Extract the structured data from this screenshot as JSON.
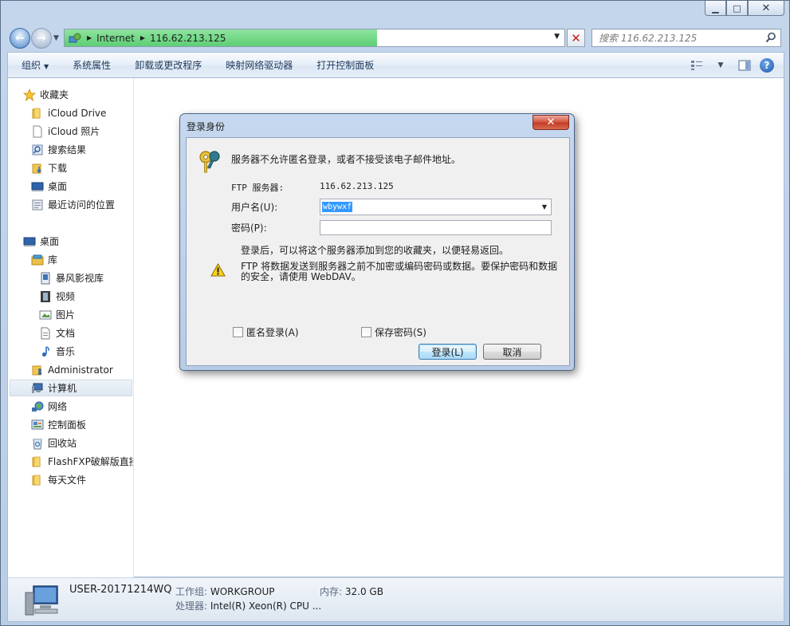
{
  "window": {
    "address": {
      "segments": [
        "Internet",
        "116.62.213.125"
      ]
    },
    "search": {
      "placeholder": "搜索 116.62.213.125"
    }
  },
  "toolbar": {
    "organize": "组织",
    "system_properties": "系统属性",
    "uninstall": "卸载或更改程序",
    "map_drive": "映射网络驱动器",
    "control_panel": "打开控制面板"
  },
  "sidebar": {
    "favorites": {
      "label": "收藏夹",
      "items": [
        "iCloud Drive",
        "iCloud 照片",
        "搜索结果",
        "下载",
        "桌面",
        "最近访问的位置"
      ]
    },
    "desktop": {
      "label": "桌面",
      "library": "库",
      "library_items": [
        "暴风影视库",
        "视频",
        "图片",
        "文档",
        "音乐"
      ],
      "items": [
        "Administrator",
        "计算机",
        "网络",
        "控制面板",
        "回收站",
        "FlashFXP破解版直接",
        "每天文件"
      ]
    }
  },
  "status": {
    "computer_name": "USER-20171214WQ",
    "workgroup_label": "工作组:",
    "workgroup_value": "WORKGROUP",
    "memory_label": "内存:",
    "memory_value": "32.0 GB",
    "cpu_label": "处理器:",
    "cpu_value": "Intel(R) Xeon(R) CPU ..."
  },
  "dialog": {
    "title": "登录身份",
    "message": "服务器不允许匿名登录，或者不接受该电子邮件地址。",
    "ftp_server_label": "FTP 服务器:",
    "ftp_server_value": "116.62.213.125",
    "username_label": "用户名(U):",
    "username_value": "wbywxf",
    "password_label": "密码(P):",
    "info_text": "登录后，可以将这个服务器添加到您的收藏夹，以便轻易返回。",
    "warning_line1": "FTP 将数据发送到服务器之前不加密或编码密码或数据。要保护密码和数据",
    "warning_line2": "的安全，请使用 WebDAV。",
    "anonymous_label": "匿名登录(A)",
    "save_password_label": "保存密码(S)",
    "login_button": "登录(L)",
    "cancel_button": "取消"
  }
}
